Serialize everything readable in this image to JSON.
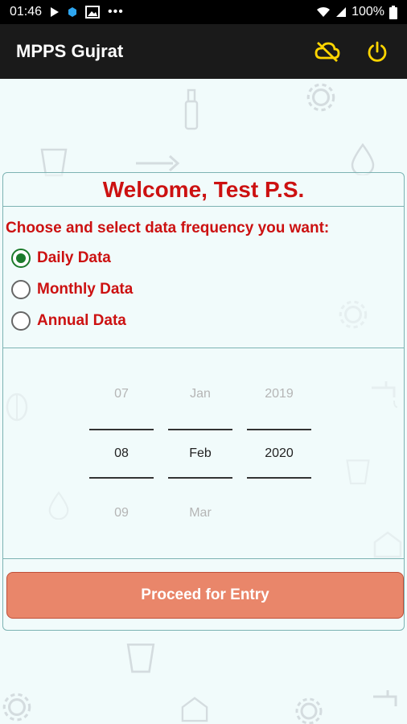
{
  "status_bar": {
    "time": "01:46",
    "battery": "100%",
    "icons": [
      "play-store-icon",
      "blue-dot-icon",
      "image-icon",
      "more-icon",
      "wifi-icon",
      "signal-icon",
      "battery-icon"
    ]
  },
  "app_bar": {
    "title": "MPPS Gujrat",
    "actions": [
      "cloud-off-icon",
      "power-icon"
    ],
    "accent": "#ffd500"
  },
  "welcome": "Welcome, Test P.S.",
  "frequency": {
    "prompt": "Choose and select data frequency you want:",
    "options": [
      "Daily Data",
      "Monthly Data",
      "Annual Data"
    ],
    "selected": "Daily Data"
  },
  "date_picker": {
    "day": {
      "prev": "07",
      "current": "08",
      "next": "09"
    },
    "month": {
      "prev": "Jan",
      "current": "Feb",
      "next": "Mar"
    },
    "year": {
      "prev": "2019",
      "current": "2020",
      "next": ""
    }
  },
  "proceed_label": "Proceed for Entry",
  "colors": {
    "label_red": "#cc1111",
    "radio_green": "#1b7a2b",
    "button": "#e9866a"
  }
}
